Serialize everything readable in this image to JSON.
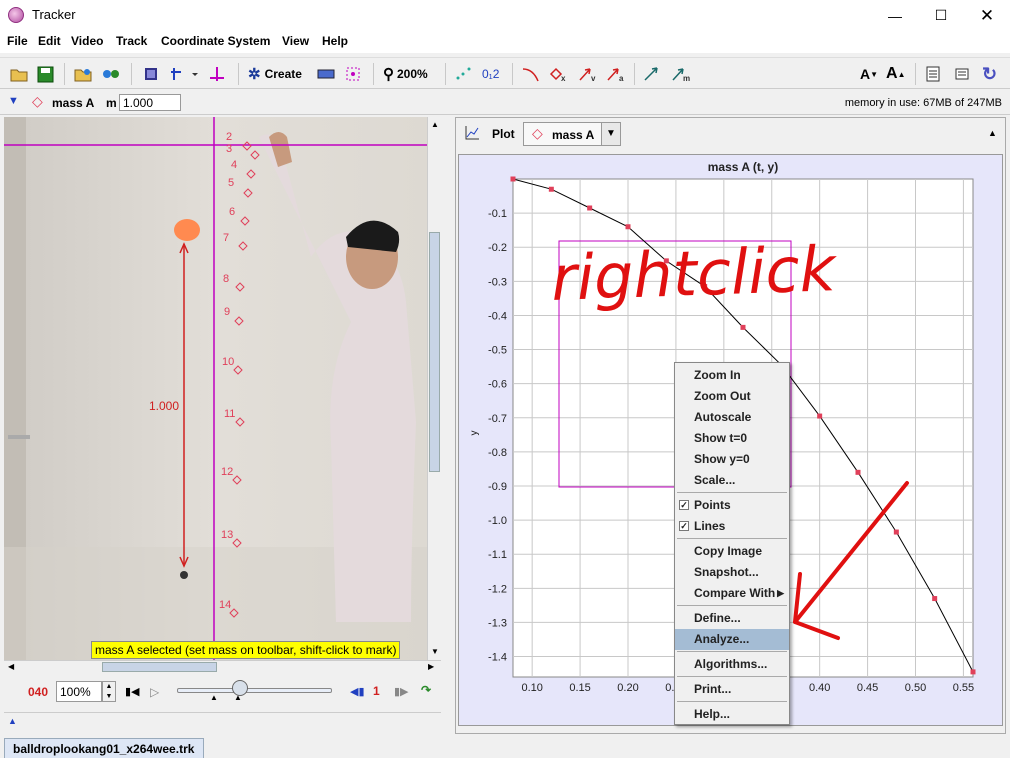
{
  "window": {
    "title": "Tracker"
  },
  "menu": [
    "File",
    "Edit",
    "Video",
    "Track",
    "Coordinate System",
    "View",
    "Help"
  ],
  "toolbar": {
    "create_label": "Create",
    "zoom_label": "200%",
    "points_label": "0₁2"
  },
  "trackbar": {
    "track_name": "mass A",
    "mass_label": "m",
    "mass_value": "1.000",
    "memory": "memory in use: 67MB of 247MB"
  },
  "video": {
    "frame_labels": [
      "2",
      "3",
      "4",
      "5",
      "6",
      "7",
      "8",
      "9",
      "10",
      "11",
      "12",
      "13",
      "14"
    ],
    "tape_value": "1.000",
    "status": "mass A selected (set mass on toolbar, shift-click to mark)"
  },
  "player": {
    "frame": "040",
    "zoom": "100%",
    "step": "1"
  },
  "plot": {
    "tab_label": "Plot",
    "track_label": "mass A",
    "title": "mass A (t, y)",
    "ylabel": "y",
    "annotation": "rightclick"
  },
  "chart_data": {
    "type": "line",
    "title": "mass A (t, y)",
    "xlabel": "",
    "ylabel": "y",
    "xlim": [
      0.08,
      0.56
    ],
    "ylim": [
      -1.46,
      0.0
    ],
    "xticks": [
      "0.10",
      "0.15",
      "0.20",
      "0.25",
      "0.30",
      "0.35",
      "0.40",
      "0.45",
      "0.50",
      "0.55"
    ],
    "yticks": [
      "-0.1",
      "-0.2",
      "-0.3",
      "-0.4",
      "-0.5",
      "-0.6",
      "-0.7",
      "-0.8",
      "-0.9",
      "-1.0",
      "-1.1",
      "-1.2",
      "-1.3",
      "-1.4"
    ],
    "grid": true,
    "series": [
      {
        "x": [
          0.08,
          0.12,
          0.16,
          0.2,
          0.24,
          0.28,
          0.32,
          0.36,
          0.4,
          0.44,
          0.48,
          0.52,
          0.56
        ],
        "y": [
          0.0,
          -0.03,
          -0.085,
          -0.14,
          -0.24,
          -0.315,
          -0.435,
          -0.545,
          -0.695,
          -0.86,
          -1.035,
          -1.23,
          -1.445
        ]
      }
    ]
  },
  "context_menu": {
    "items": [
      "Zoom In",
      "Zoom Out",
      "Autoscale",
      "Show t=0",
      "Show y=0",
      "Scale...",
      "Points",
      "Lines",
      "Copy Image",
      "Snapshot...",
      "Compare With",
      "Define...",
      "Analyze...",
      "Algorithms...",
      "Print...",
      "Help..."
    ]
  },
  "file_tab": "balldroplookang01_x264wee.trk",
  "colors": {
    "magenta": "#c000c0",
    "track": "#e0405a",
    "annotation": "#e01010",
    "highlight": "#a4bcd4"
  }
}
